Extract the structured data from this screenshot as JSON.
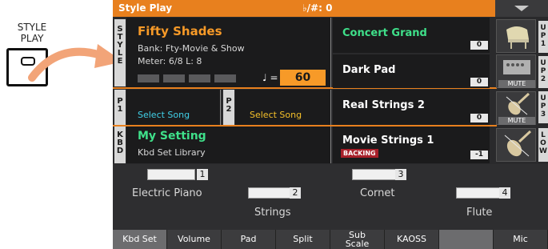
{
  "hardware": {
    "label_line1": "STYLE",
    "label_line2": "PLAY"
  },
  "topbar": {
    "title": "Style Play",
    "key_transpose": "♭/#: 0"
  },
  "style": {
    "name": "Fifty Shades",
    "bank": "Bank: Fty-Movie & Show",
    "meter": "Meter:  6/8 L:   8",
    "tempo_symbol": "♩ =",
    "tempo": "60",
    "side_label": [
      "S",
      "T",
      "Y",
      "L",
      "E"
    ]
  },
  "players": {
    "p1_label": [
      "P",
      "1"
    ],
    "p1_song": "Select Song",
    "p2_label": [
      "P",
      "2"
    ],
    "p2_song": "Select Song"
  },
  "keyboard_set": {
    "side_label": [
      "K",
      "B",
      "D"
    ],
    "name": "My Setting",
    "library": "Kbd Set Library"
  },
  "sounds": [
    {
      "name": "Concert Grand",
      "octave": "0",
      "icon": "piano-icon",
      "mute": "",
      "tab": [
        "U",
        "P",
        "1"
      ]
    },
    {
      "name": "Dark Pad",
      "octave": "0",
      "icon": "synth-pad-icon",
      "mute": "MUTE",
      "tab": [
        "U",
        "P",
        "2"
      ]
    },
    {
      "name": "Real Strings 2",
      "octave": "0",
      "icon": "violin-icon",
      "mute": "MUTE",
      "tab": [
        "U",
        "P",
        "3"
      ]
    },
    {
      "name": "Movie Strings 1",
      "badge": "BACKING",
      "octave": "-1",
      "icon": "violin-icon",
      "mute": "",
      "tab": [
        "L",
        "O",
        "W"
      ]
    }
  ],
  "sub_sounds": [
    {
      "num": "1",
      "label": "Electric Piano"
    },
    {
      "num": "2",
      "label": "Strings"
    },
    {
      "num": "3",
      "label": "Cornet"
    },
    {
      "num": "4",
      "label": "Flute"
    }
  ],
  "tabs": [
    {
      "label": "Kbd Set",
      "active": true
    },
    {
      "label": "Volume"
    },
    {
      "label": "Pad"
    },
    {
      "label": "Split"
    },
    {
      "label": "Sub Scale"
    },
    {
      "label": "KAOSS"
    },
    {
      "label": ""
    },
    {
      "label": "Mic"
    }
  ],
  "colors": {
    "accent_orange": "#f79a28",
    "title_bar": "#e8801e",
    "green_text": "#3fe08a",
    "backing_badge": "#a8202a"
  }
}
